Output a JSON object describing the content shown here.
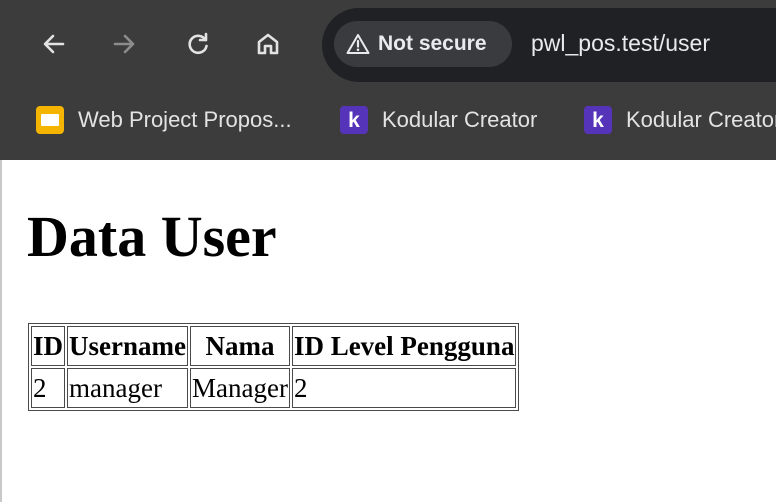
{
  "browser": {
    "nav": {
      "back_icon": "arrow-left-icon",
      "forward_icon": "arrow-right-icon",
      "reload_icon": "reload-icon",
      "home_icon": "home-icon"
    },
    "security": {
      "icon": "warning-triangle-icon",
      "label": "Not secure"
    },
    "url": "pwl_pos.test/user",
    "bookmarks": [
      {
        "icon": "google-slides-icon",
        "label": "Web Project Propos..."
      },
      {
        "icon": "kodular-icon",
        "label": "Kodular Creator",
        "glyph": "k"
      },
      {
        "icon": "kodular-icon",
        "label": "Kodular Creator",
        "glyph": "k"
      }
    ],
    "colors": {
      "toolbar": "#3c3c3c",
      "omnibox": "#202124",
      "text": "#e8eaed",
      "kodular": "#5534b9",
      "slides": "#f4b400"
    }
  },
  "page": {
    "title": "Data User",
    "table": {
      "headers": [
        "ID",
        "Username",
        "Nama",
        "ID Level Pengguna"
      ],
      "rows": [
        [
          "2",
          "manager",
          "Manager",
          "2"
        ]
      ]
    }
  }
}
